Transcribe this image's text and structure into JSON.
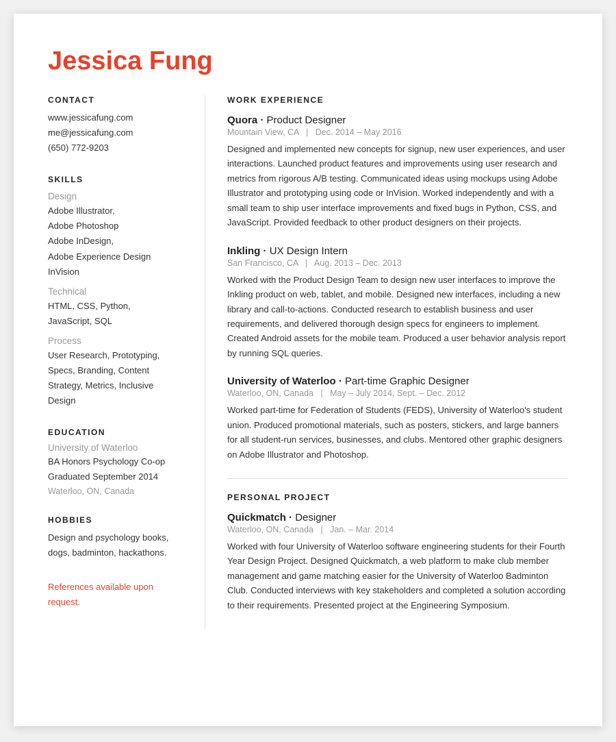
{
  "name": "Jessica Fung",
  "left": {
    "contact": {
      "title": "CONTACT",
      "items": [
        "www.jessicafung.com",
        "me@jessicafung.com",
        "(650) 772-9203"
      ]
    },
    "skills": {
      "title": "SKILLS",
      "categories": [
        {
          "name": "Design",
          "items": "Adobe Illustrator,\nAdobe Photoshop\nAdobe InDesign,\nAdobe Experience Design\nInVision"
        },
        {
          "name": "Technical",
          "items": "HTML, CSS, Python,\nJavaScript, SQL"
        },
        {
          "name": "Process",
          "items": "User Research, Prototyping,\nSpecs, Branding, Content\nStrategy, Metrics, Inclusive\nDesign"
        }
      ]
    },
    "education": {
      "title": "EDUCATION",
      "school": "University of Waterloo",
      "degree": "BA Honors Psychology Co-op\nGraduated September 2014",
      "location": "Waterloo, ON, Canada"
    },
    "hobbies": {
      "title": "HOBBIES",
      "text": "Design and psychology books,\ndogs, badminton, hackathons."
    },
    "references": "References available upon\nrequest."
  },
  "right": {
    "work_experience": {
      "title": "WORK EXPERIENCE",
      "jobs": [
        {
          "company": "Quora",
          "role": "Product Designer",
          "meta": "Mountain View, CA   |   Dec. 2014 – May 2016",
          "desc": "Designed and implemented new concepts for signup, new user experiences, and user interactions. Launched product features and improvements using user research and metrics from rigorous A/B testing. Communicated ideas using mockups using Adobe Illustrator and prototyping using code or InVision. Worked independently and with a small team to ship user interface improvements and fixed bugs in Python, CSS, and JavaScript. Provided feedback to other product designers on their projects."
        },
        {
          "company": "Inkling",
          "role": "UX Design Intern",
          "meta": "San Francisco, CA   |   Aug. 2013 – Dec. 2013",
          "desc": "Worked with the Product Design Team to design new user interfaces to improve the Inkling product on web, tablet, and mobile. Designed new interfaces, including a new library and call-to-actions. Conducted research to establish business and user requirements, and delivered thorough design specs for engineers to implement. Created Android assets for the mobile team. Produced a user behavior analysis report by running SQL queries."
        },
        {
          "company": "University of Waterloo",
          "role": "Part-time Graphic Designer",
          "meta": "Waterloo, ON, Canada   |   May – July 2014,  Sept. – Dec. 2012",
          "desc": "Worked part-time for Federation of Students (FEDS), University of Waterloo's student union. Produced promotional materials, such as posters, stickers, and large banners for all student-run services, businesses, and clubs. Mentored other graphic designers on Adobe Illustrator and Photoshop."
        }
      ]
    },
    "personal_project": {
      "title": "PERSONAL PROJECT",
      "jobs": [
        {
          "company": "Quickmatch",
          "role": "Designer",
          "meta": "Waterloo, ON, Canada   |   Jan.  – Mar. 2014",
          "desc": "Worked with four University of Waterloo software engineering students for their Fourth Year Design Project. Designed Quickmatch, a web platform to make club member management and game matching easier for the University of Waterloo Badminton Club. Conducted interviews with key stakeholders and completed a solution according to their requirements. Presented project at the Engineering Symposium."
        }
      ]
    }
  }
}
